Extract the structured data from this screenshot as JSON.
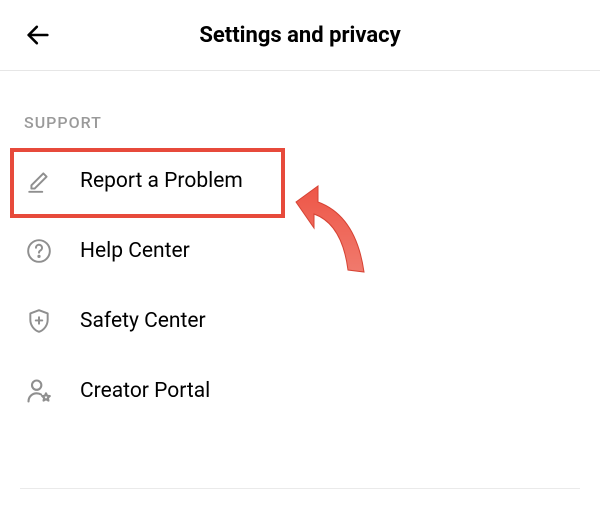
{
  "header": {
    "title": "Settings and privacy"
  },
  "section": {
    "label": "SUPPORT"
  },
  "menu": {
    "items": [
      {
        "icon": "pencil-icon",
        "label": "Report a Problem"
      },
      {
        "icon": "question-icon",
        "label": "Help Center"
      },
      {
        "icon": "shield-plus-icon",
        "label": "Safety Center"
      },
      {
        "icon": "person-star-icon",
        "label": "Creator Portal"
      }
    ]
  },
  "annotation": {
    "highlight_color": "#e74a3b",
    "arrow_color": "#ef5a4a"
  }
}
